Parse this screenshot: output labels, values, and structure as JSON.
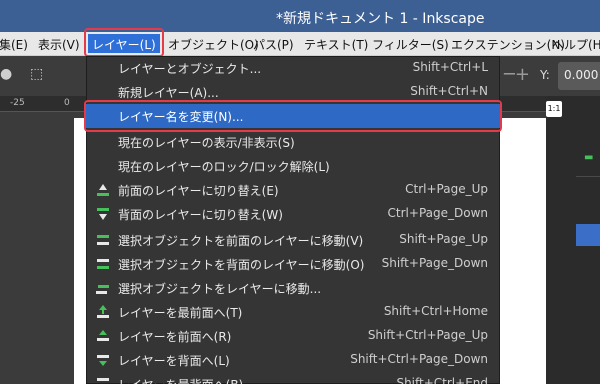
{
  "window": {
    "title": "*新規ドキュメント 1 - Inkscape"
  },
  "menubar": {
    "items": [
      {
        "id": "edit",
        "label": "集(E)"
      },
      {
        "id": "view",
        "label": "表示(V)"
      },
      {
        "id": "layer",
        "label": "レイヤー(L)"
      },
      {
        "id": "object",
        "label": "オブジェクト(O)"
      },
      {
        "id": "path",
        "label": "パス(P)"
      },
      {
        "id": "text",
        "label": "テキスト(T)"
      },
      {
        "id": "filters",
        "label": "フィルター(S)"
      },
      {
        "id": "extensions",
        "label": "エクステンション(N)"
      },
      {
        "id": "help",
        "label": "ヘルプ(H"
      }
    ]
  },
  "toolbar": {
    "y_label": "Y:",
    "y_value": "0.000"
  },
  "ruler": {
    "ticks": [
      "-25",
      "0"
    ]
  },
  "layer_menu": {
    "items": [
      {
        "label": "レイヤーとオブジェクト...",
        "shortcut": "Shift+Ctrl+L",
        "icon": "none"
      },
      {
        "label": "新規レイヤー(A)...",
        "shortcut": "Shift+Ctrl+N",
        "icon": "none"
      },
      {
        "label": "レイヤー名を変更(N)...",
        "shortcut": "",
        "icon": "none",
        "selected": true
      },
      {
        "label": "現在のレイヤーの表示/非表示(S)",
        "shortcut": "",
        "icon": "none"
      },
      {
        "label": "現在のレイヤーのロック/ロック解除(L)",
        "shortcut": "",
        "icon": "none"
      },
      {
        "label": "前面のレイヤーに切り替え(E)",
        "shortcut": "Ctrl+Page_Up",
        "icon": "layer-up-icon"
      },
      {
        "label": "背面のレイヤーに切り替え(W)",
        "shortcut": "Ctrl+Page_Down",
        "icon": "layer-down-icon"
      },
      {
        "label": "選択オブジェクトを前面のレイヤーに移動(V)",
        "shortcut": "Shift+Page_Up",
        "icon": "move-to-layer-above-icon"
      },
      {
        "label": "選択オブジェクトを背面のレイヤーに移動(O)",
        "shortcut": "Shift+Page_Down",
        "icon": "move-to-layer-below-icon"
      },
      {
        "label": "選択オブジェクトをレイヤーに移動...",
        "shortcut": "",
        "icon": "move-to-layer-icon"
      },
      {
        "label": "レイヤーを最前面へ(T)",
        "shortcut": "Shift+Ctrl+Home",
        "icon": "layer-top-icon"
      },
      {
        "label": "レイヤーを前面へ(R)",
        "shortcut": "Shift+Ctrl+Page_Up",
        "icon": "layer-raise-icon"
      },
      {
        "label": "レイヤーを背面へ(L)",
        "shortcut": "Shift+Ctrl+Page_Down",
        "icon": "layer-lower-icon"
      },
      {
        "label": "レイヤーを最背面へ(B)",
        "shortcut": "Shift+Ctrl+End",
        "icon": "layer-bottom-icon"
      }
    ]
  },
  "rightpanel": {
    "zoom_button": "1:1"
  },
  "colors": {
    "accent_selected": "#2e6ac5",
    "highlight_outline": "#e33b4a",
    "titlebar": "#3c5f94"
  }
}
